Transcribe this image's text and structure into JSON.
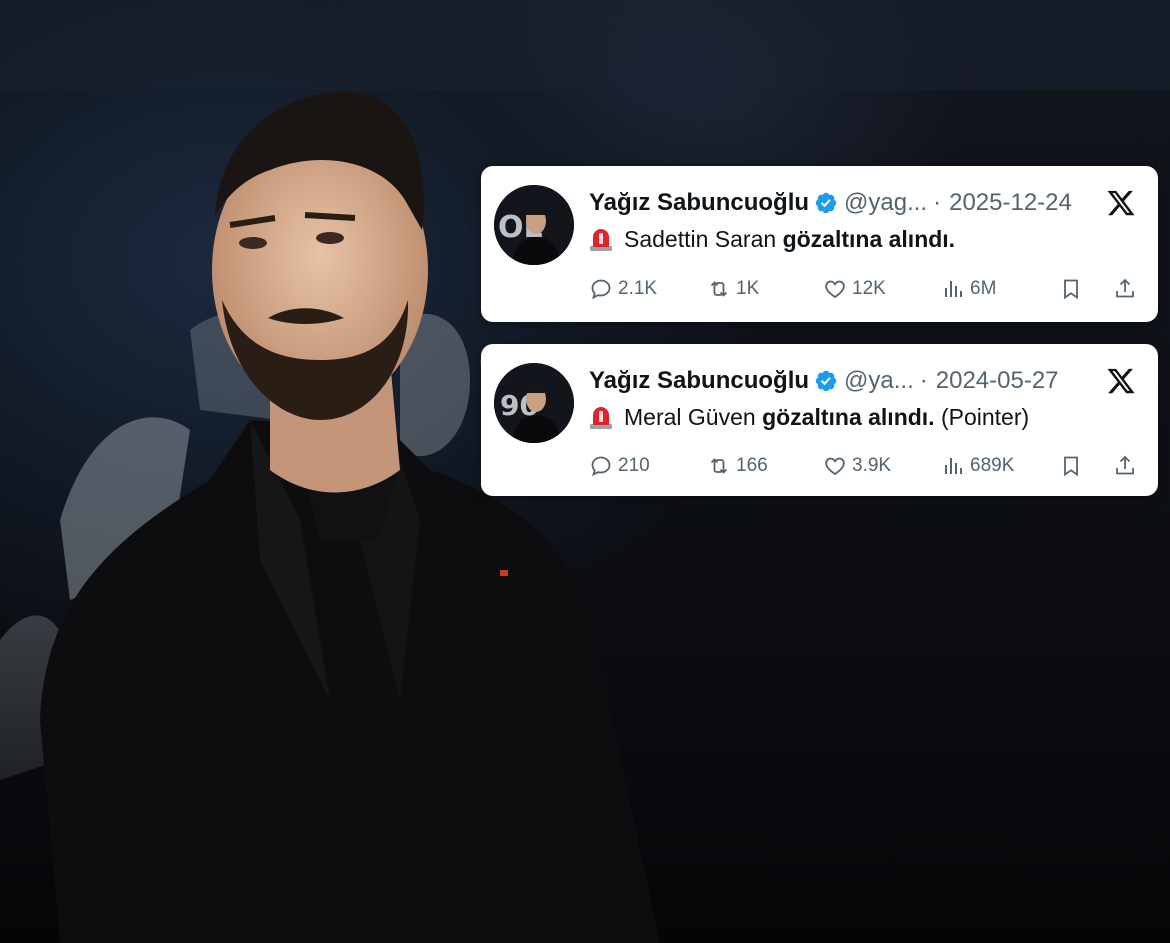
{
  "tweets": [
    {
      "name": "Yağız Sabuncuoğlu",
      "handle": "@yag...",
      "separator": "·",
      "date": "2025-12-24",
      "text_plain": "Sadettin Saran",
      "text_bold": "gözaltına alındı.",
      "text_suffix": "",
      "replies": "2.1K",
      "retweets": "1K",
      "likes": "12K",
      "views": "6M"
    },
    {
      "name": "Yağız Sabuncuoğlu",
      "handle": "@ya...",
      "separator": "·",
      "date": "2024-05-27",
      "text_plain": "Meral Güven",
      "text_bold": "gözaltına alındı.",
      "text_suffix": "(Pointer)",
      "replies": "210",
      "retweets": "166",
      "likes": "3.9K",
      "views": "689K"
    }
  ],
  "icons": {
    "verified": "verified-badge-icon",
    "x_logo": "x-logo-icon",
    "siren": "rotating-light-emoji",
    "reply": "reply-icon",
    "retweet": "retweet-icon",
    "like": "heart-icon",
    "views": "views-icon",
    "bookmark": "bookmark-icon",
    "share": "share-icon"
  },
  "colors": {
    "verified": "#1d9bf0",
    "text": "#0f1419",
    "muted": "#536471",
    "card": "#ffffff",
    "siren_red": "#e0242c"
  }
}
